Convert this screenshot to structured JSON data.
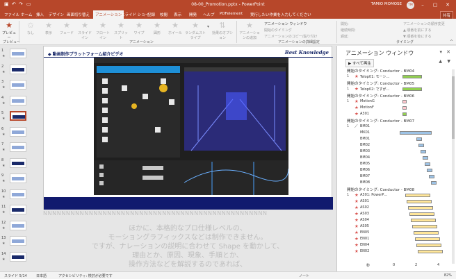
{
  "window": {
    "title": "08-00_Promotion.pptx  -  PowerPoint",
    "user": "TAMIO MOMOSE",
    "user_initials": "TM",
    "share_label": "共有"
  },
  "tabs": [
    "ファイル",
    "ホーム",
    "挿入",
    "デザイン",
    "画面切り替え",
    "アニメーション",
    "スライド ショー",
    "記録",
    "校閲",
    "表示",
    "開発",
    "ヘルプ",
    "PDFelement",
    "実行したい作業を入力してください"
  ],
  "active_tab": "アニメーション",
  "ribbon": {
    "preview_label": "プレビュー",
    "preview_group": "プレビュー",
    "animations": [
      "なし",
      "表示",
      "フェード",
      "スライドイン",
      "フロートイン",
      "スプリット",
      "ワイプ",
      "図形",
      "ホイール",
      "ランダムストライプ"
    ],
    "effect_options": "効果のオプション",
    "animation_group": "アニメーション",
    "add_animation": "アニメーションの追加",
    "anim_pane_btn": "アニメーション ウィンドウ",
    "trigger_btn": "開始のタイミング",
    "painter_btn": "アニメーションのコピー/貼り付け",
    "advanced_group": "アニメーションの詳細設定",
    "start_label": "開始:",
    "duration_label": "継続時間:",
    "delay_label": "遅延:",
    "reorder_label": "アニメーションの順序変更",
    "move_earlier": "▲ 順番を前にする",
    "move_later": "▼ 順番を後にする",
    "timing_group": "タイミング"
  },
  "slides": [
    {
      "num": "1"
    },
    {
      "num": "2"
    },
    {
      "num": "3"
    },
    {
      "num": "4"
    },
    {
      "num": "5"
    },
    {
      "num": "6"
    },
    {
      "num": "7"
    },
    {
      "num": "8"
    },
    {
      "num": "9"
    },
    {
      "num": "10"
    },
    {
      "num": "11"
    },
    {
      "num": "12"
    },
    {
      "num": "13"
    },
    {
      "num": "14"
    }
  ],
  "selected_slide": "5",
  "slide": {
    "title": "◆ 動画制作プラットフォーム紹介ビデオ",
    "brand": "Best Knowledge",
    "overflow_row": "NNNNNNNNNNNNNNNNNNNNNNNNNNNNNNNNNNNNNNNNNNNNNNNNN",
    "body_lines": [
      "ほかに、本格的なプロ仕様レベルの、",
      "モーショングラフィックスなどは制作できません。",
      "ですが、ナレーションの説明に合わせて Shape を動かして、",
      "理由とか、原因、現象、手順とか、",
      "操作方法などを解説するのであれば、"
    ]
  },
  "anim_pane": {
    "title": "アニメーション ウィンドウ",
    "play_all": "すべて再生",
    "groups": [
      {
        "label": "開始のタイミング: Conductor - BM04",
        "items": [
          {
            "num": "1",
            "icon": "star",
            "name": "Telop01: モーシ…",
            "color": "#92d050"
          }
        ]
      },
      {
        "label": "開始のタイミング: Conductor - BM05",
        "items": [
          {
            "num": "1",
            "icon": "star",
            "name": "Telop02: ですが…",
            "color": "#92d050"
          }
        ]
      },
      {
        "label": "開始のタイミング: Conductor - BM06",
        "items": [
          {
            "num": "1",
            "icon": "star",
            "name": "MotionG",
            "color": "#ffc7ce"
          },
          {
            "num": "",
            "icon": "star",
            "name": "MotionF",
            "color": "#ffc7ce"
          },
          {
            "num": "",
            "icon": "star",
            "name": "A301",
            "color": "#92d050"
          }
        ]
      },
      {
        "label": "開始のタイミング: Conductor - BM07",
        "items": [
          {
            "num": "1",
            "icon": "line",
            "name": "BM01",
            "color": "#9dc3e6"
          },
          {
            "num": "",
            "icon": "none",
            "name": "MK01",
            "color": "#9dc3e6"
          },
          {
            "num": "",
            "icon": "none",
            "name": "BM01",
            "color": "#9dc3e6"
          },
          {
            "num": "",
            "icon": "none",
            "name": "BM02",
            "color": "#9dc3e6"
          },
          {
            "num": "",
            "icon": "none",
            "name": "BM03",
            "color": "#9dc3e6"
          },
          {
            "num": "",
            "icon": "none",
            "name": "BM04",
            "color": "#9dc3e6"
          },
          {
            "num": "",
            "icon": "none",
            "name": "BM05",
            "color": "#9dc3e6"
          },
          {
            "num": "",
            "icon": "none",
            "name": "BM06",
            "color": "#9dc3e6"
          },
          {
            "num": "",
            "icon": "none",
            "name": "BM07",
            "color": "#9dc3e6"
          },
          {
            "num": "",
            "icon": "none",
            "name": "BM08",
            "color": "#9dc3e6"
          }
        ]
      },
      {
        "label": "開始のタイミング: Conductor - BM08",
        "items": [
          {
            "num": "1",
            "icon": "star",
            "name": "A301: PowerP…",
            "color": "#ffe699"
          },
          {
            "num": "",
            "icon": "star",
            "name": "AS01",
            "color": "#ffe699"
          },
          {
            "num": "",
            "icon": "star",
            "name": "AS02",
            "color": "#ffe699"
          },
          {
            "num": "",
            "icon": "star",
            "name": "AS03",
            "color": "#ffe699"
          },
          {
            "num": "",
            "icon": "star",
            "name": "AS04",
            "color": "#ffe699"
          },
          {
            "num": "",
            "icon": "star",
            "name": "AS05",
            "color": "#ffe699"
          },
          {
            "num": "",
            "icon": "star",
            "name": "EN05",
            "color": "#ffe699"
          },
          {
            "num": "",
            "icon": "star",
            "name": "EN01",
            "color": "#ffe699"
          },
          {
            "num": "",
            "icon": "star",
            "name": "EN04",
            "color": "#ffe699"
          },
          {
            "num": "",
            "icon": "star",
            "name": "EN02",
            "color": "#ffe699"
          }
        ]
      }
    ],
    "seconds_label": "秒",
    "ticks": [
      "0",
      "2",
      "4"
    ]
  },
  "status": {
    "slide_pos": "スライド 5/14",
    "language": "日本語",
    "accessibility": "アクセシビリティ: 検討が必要です",
    "notes": "ノート",
    "zoom": "82%"
  },
  "colors": {
    "accent": "#b7472a",
    "slide_banner": "#111a6e"
  }
}
